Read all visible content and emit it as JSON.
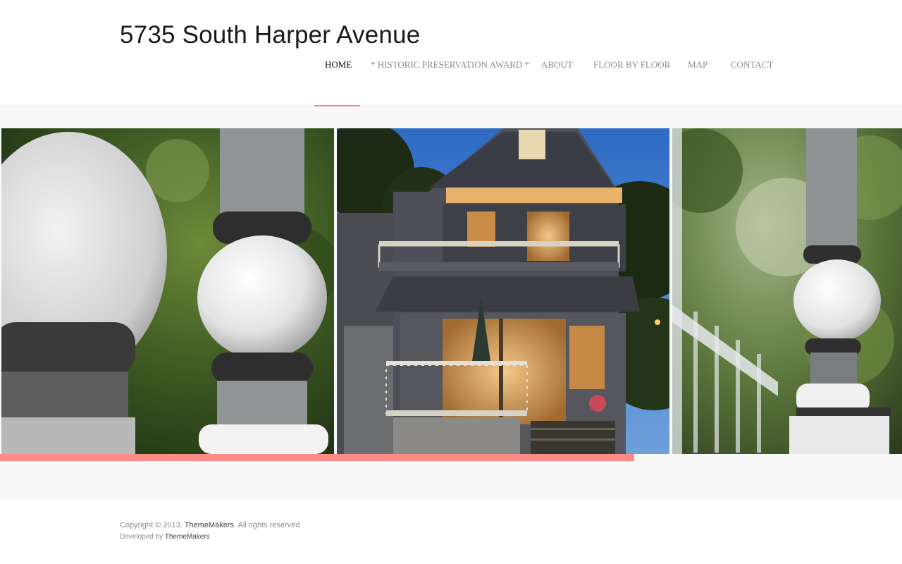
{
  "site": {
    "title": "5735 South Harper Avenue"
  },
  "nav": {
    "items": [
      {
        "label": "HOME",
        "active": true
      },
      {
        "label": "* HISTORIC PRESERVATION AWARD *",
        "active": false
      },
      {
        "label": "ABOUT",
        "active": false
      },
      {
        "label": "FLOOR BY FLOOR",
        "active": false
      },
      {
        "label": "MAP",
        "active": false
      },
      {
        "label": "CONTACT",
        "active": false
      }
    ]
  },
  "slider": {
    "slides": [
      {
        "subject": "porch-baluster-closeup"
      },
      {
        "subject": "house-rear-porch-night"
      },
      {
        "subject": "porch-post-garden"
      }
    ],
    "progress_percent": 70.3
  },
  "footer": {
    "copyright_prefix": "Copyright © 2013.",
    "copyright_link": "ThemeMakers",
    "copyright_suffix": ". All rights reserved",
    "developed_prefix": "Developed by",
    "developed_link": "ThemeMakers"
  },
  "colors": {
    "accent": "#ff8a85",
    "nav_active": "#111111",
    "nav_inactive": "#8a8a8a",
    "band_background": "#f8f8f8"
  }
}
